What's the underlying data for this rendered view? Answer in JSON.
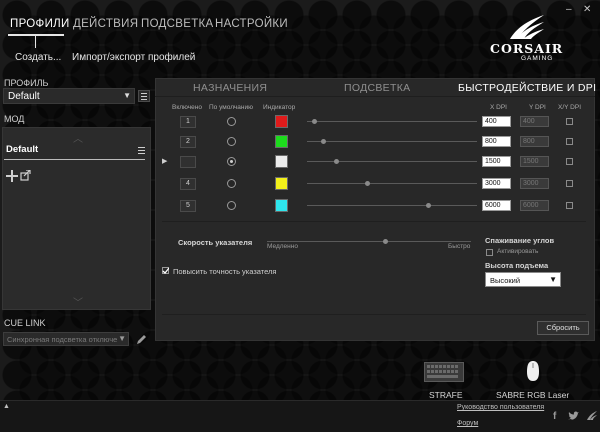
{
  "nav": {
    "tabs": [
      {
        "label": "ПРОФИЛИ",
        "active": true
      },
      {
        "label": "ДЕЙСТВИЯ",
        "active": false
      },
      {
        "label": "ПОДСВЕТКА",
        "active": false
      },
      {
        "label": "НАСТРОЙКИ",
        "active": false
      }
    ],
    "create": "Создать...",
    "import_export": "Импорт/экспорт профилей"
  },
  "window": {
    "minimize": "–",
    "close": "✕"
  },
  "logo": {
    "name": "CORSAIR",
    "sub": "GAMING"
  },
  "sidebar": {
    "profile_label": "ПРОФИЛЬ",
    "profile_value": "Default",
    "mode_label": "МОД",
    "mode_item": "Default",
    "cue_link_label": "CUE LINK",
    "cue_link_value": "Синхронная подсветка отключе"
  },
  "main": {
    "tabs": [
      {
        "label": "НАЗНАЧЕНИЯ",
        "active": false
      },
      {
        "label": "ПОДСВЕТКА",
        "active": false
      },
      {
        "label": "БЫСТРОДЕЙСТВИЕ И DPI",
        "active": true
      }
    ],
    "columns": {
      "enabled": "Включено",
      "default": "По умолчанию",
      "indicator": "Индикатор",
      "x_dpi": "X DPI",
      "y_dpi": "Y DPI",
      "xy_dpi": "X/Y DPI"
    },
    "rows": [
      {
        "num": "1",
        "color": "#e01b1b",
        "x_dpi": "400",
        "y_dpi": "400",
        "slider": 0.03,
        "default": false
      },
      {
        "num": "2",
        "color": "#1ddc1d",
        "x_dpi": "800",
        "y_dpi": "800",
        "slider": 0.08,
        "default": false
      },
      {
        "num": "",
        "color": "#ececec",
        "x_dpi": "1500",
        "y_dpi": "1500",
        "slider": 0.16,
        "default": true
      },
      {
        "num": "4",
        "color": "#f2f01a",
        "x_dpi": "3000",
        "y_dpi": "3000",
        "slider": 0.34,
        "default": false
      },
      {
        "num": "5",
        "color": "#2ee5ec",
        "x_dpi": "6000",
        "y_dpi": "6000",
        "slider": 0.7,
        "default": false
      }
    ],
    "pointer_speed": {
      "label": "Скорость указателя",
      "slow": "Медленно",
      "fast": "Быстро",
      "value": 0.58
    },
    "precision_label": "Повысить точность указателя",
    "angle_snapping": {
      "label": "Спаживание углов",
      "activate": "Активировать"
    },
    "lift_height": {
      "label": "Высота подъема",
      "value": "Высокий"
    },
    "reset": "Сбросить"
  },
  "devices": [
    {
      "name": "STRAFE",
      "icon": "keyboard-icon"
    },
    {
      "name": "SABRE RGB Laser",
      "icon": "mouse-icon"
    }
  ],
  "footer": {
    "user_guide": "Руководство пользователя",
    "forum": "Форум",
    "collapse": "▲"
  }
}
